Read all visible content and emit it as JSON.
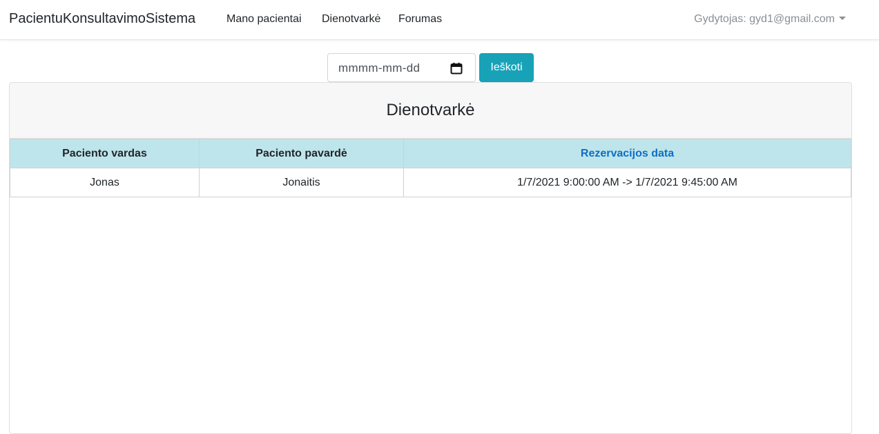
{
  "navbar": {
    "brand": "PacientuKonsultavimoSistema",
    "links": [
      "Mano pacientai",
      "Dienotvarkė",
      "Forumas"
    ],
    "user": "Gydytojas: gyd1@gmail.com"
  },
  "search": {
    "date_placeholder": "mmmm-mm-dd",
    "button_label": "Ieškoti"
  },
  "card": {
    "title": "Dienotvarkė"
  },
  "table": {
    "columns": [
      "Paciento vardas",
      "Paciento pavardė",
      "Rezervacijos data"
    ],
    "rows": [
      [
        "Jonas",
        "Jonaitis",
        "1/7/2021 9:00:00 AM -> 1/7/2021 9:45:00 AM"
      ]
    ]
  },
  "colors": {
    "accent": "#17a2b8",
    "table_header_bg": "#bee5eb",
    "link_header": "#0d6ec6"
  }
}
